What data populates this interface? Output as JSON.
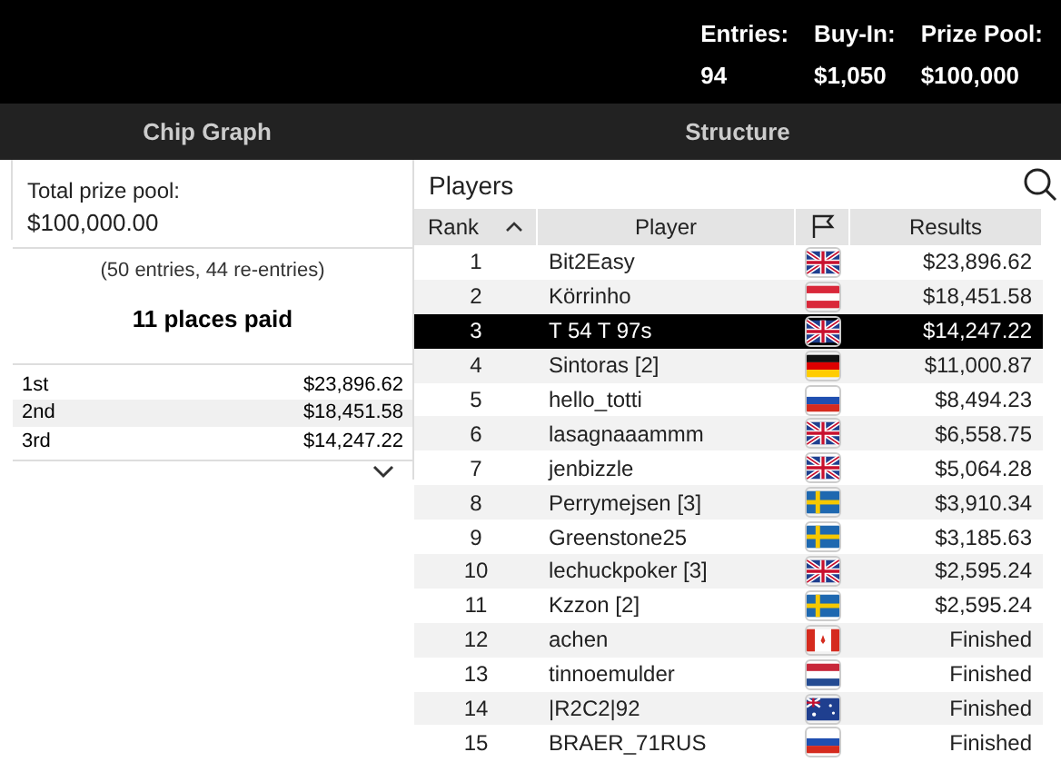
{
  "header": {
    "stats": [
      {
        "label": "Entries:",
        "value": "94"
      },
      {
        "label": "Buy-In:",
        "value": "$1,050"
      },
      {
        "label": "Prize Pool:",
        "value": "$100,000"
      }
    ]
  },
  "tabs": [
    {
      "label": "Chip Graph",
      "selected": false
    },
    {
      "label": "Structure",
      "selected": false
    }
  ],
  "prize_panel": {
    "total_label": "Total prize pool:",
    "total_value": "$100,000.00",
    "entries_note": "(50 entries, 44 re-entries)",
    "places_paid": "11 places paid",
    "payouts": [
      {
        "place": "1st",
        "amount": "$23,896.62"
      },
      {
        "place": "2nd",
        "amount": "$18,451.58"
      },
      {
        "place": "3rd",
        "amount": "$14,247.22"
      }
    ]
  },
  "players": {
    "title": "Players",
    "columns": [
      "Rank",
      "Player",
      "Results"
    ],
    "rows": [
      {
        "rank": "1",
        "player": "Bit2Easy",
        "kind": "gb",
        "result": "$23,896.62",
        "selected": false
      },
      {
        "rank": "2",
        "player": "Körrinho",
        "kind": "at",
        "result": "$18,451.58",
        "selected": false
      },
      {
        "rank": "3",
        "player": "T 54 T 97s",
        "kind": "gb",
        "result": "$14,247.22",
        "selected": true
      },
      {
        "rank": "4",
        "player": "Sintoras [2]",
        "kind": "de",
        "result": "$11,000.87",
        "selected": false
      },
      {
        "rank": "5",
        "player": "hello_totti",
        "kind": "ru",
        "result": "$8,494.23",
        "selected": false
      },
      {
        "rank": "6",
        "player": "lasagnaaammm",
        "kind": "gb",
        "result": "$6,558.75",
        "selected": false
      },
      {
        "rank": "7",
        "player": "jenbizzle",
        "kind": "gb",
        "result": "$5,064.28",
        "selected": false
      },
      {
        "rank": "8",
        "player": "Perrymejsen [3]",
        "kind": "se",
        "result": "$3,910.34",
        "selected": false
      },
      {
        "rank": "9",
        "player": "Greenstone25",
        "kind": "se",
        "result": "$3,185.63",
        "selected": false
      },
      {
        "rank": "10",
        "player": "lechuckpoker [3]",
        "kind": "gb",
        "result": "$2,595.24",
        "selected": false
      },
      {
        "rank": "11",
        "player": "Kzzon [2]",
        "kind": "se",
        "result": "$2,595.24",
        "selected": false
      },
      {
        "rank": "12",
        "player": "achen",
        "kind": "ca",
        "result": "Finished",
        "selected": false
      },
      {
        "rank": "13",
        "player": "tinnoemulder",
        "kind": "nl",
        "result": "Finished",
        "selected": false
      },
      {
        "rank": "14",
        "player": "|R2C2|92",
        "kind": "au",
        "result": "Finished",
        "selected": false
      },
      {
        "rank": "15",
        "player": "BRAER_71RUS",
        "kind": "ru",
        "result": "Finished",
        "selected": false
      }
    ]
  }
}
